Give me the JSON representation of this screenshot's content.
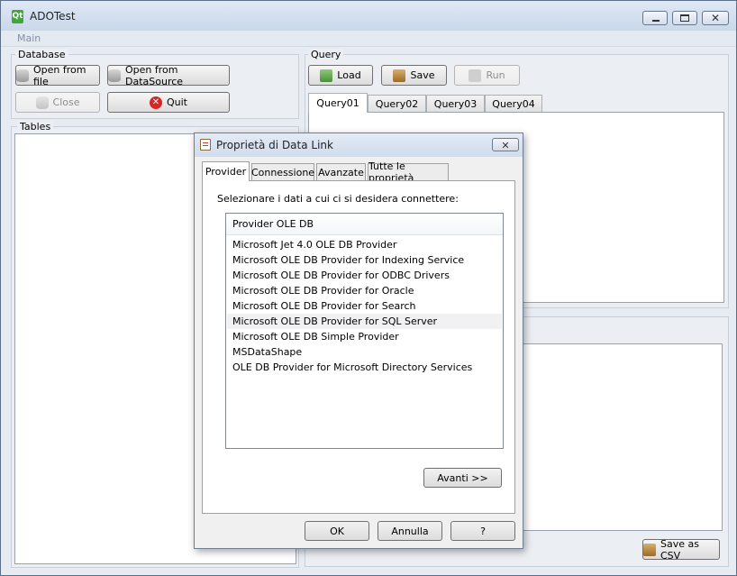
{
  "window": {
    "title": "ADOTest",
    "icon": "qt-app-icon"
  },
  "menu": [
    "Main"
  ],
  "database": {
    "group_title": "Database",
    "buttons": {
      "open_file": "Open from file",
      "open_datasource": "Open from DataSource",
      "close": "Close",
      "quit": "Quit"
    }
  },
  "tables": {
    "group_title": "Tables"
  },
  "query": {
    "group_title": "Query",
    "buttons": {
      "load": "Load",
      "save": "Save",
      "run": "Run"
    },
    "tabs": [
      "Query01",
      "Query02",
      "Query03",
      "Query04"
    ],
    "active_tab": "Query01"
  },
  "results": {
    "save_csv": "Save as CSV"
  },
  "dialog": {
    "title": "Proprietà di Data Link",
    "tabs": [
      "Provider",
      "Connessione",
      "Avanzate",
      "Tutte le proprietà"
    ],
    "active_tab": "Provider",
    "instruction": "Selezionare i dati a cui ci si desidera connettere:",
    "list_header": "Provider OLE DB",
    "providers": [
      "Microsoft Jet 4.0 OLE DB Provider",
      "Microsoft OLE DB Provider for Indexing Service",
      "Microsoft OLE DB Provider for ODBC Drivers",
      "Microsoft OLE DB Provider for Oracle",
      "Microsoft OLE DB Provider for Search",
      "Microsoft OLE DB Provider for SQL Server",
      "Microsoft OLE DB Simple Provider",
      "MSDataShape",
      "OLE DB Provider for Microsoft Directory Services"
    ],
    "highlighted_provider": "Microsoft OLE DB Provider for SQL Server",
    "next_button": "Avanti >>",
    "ok": "OK",
    "cancel": "Annulla",
    "help": "?"
  }
}
